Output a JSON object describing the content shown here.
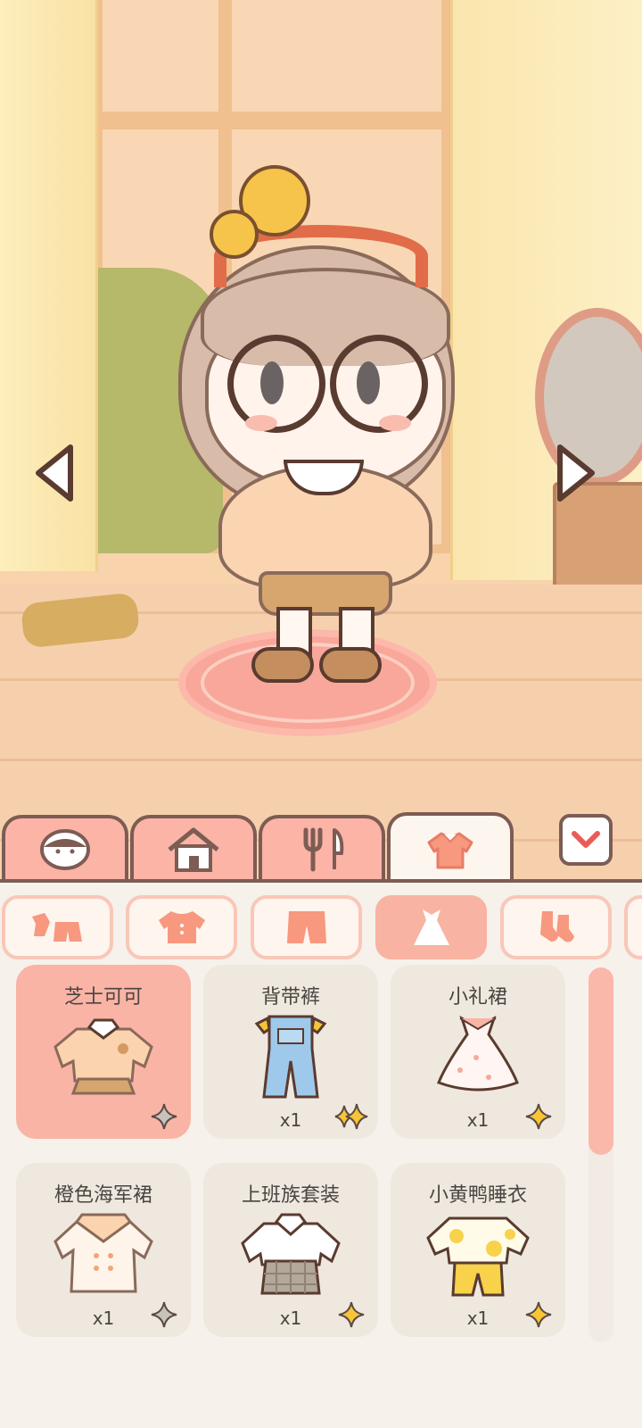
{
  "scene": {
    "prev_arrow": "chevron-left-icon",
    "next_arrow": "chevron-right-icon"
  },
  "main_tabs": [
    {
      "name": "face",
      "icon": "face-icon",
      "active": false
    },
    {
      "name": "home",
      "icon": "house-icon",
      "active": false
    },
    {
      "name": "food",
      "icon": "fork-knife-icon",
      "active": false
    },
    {
      "name": "clothes",
      "icon": "shirt-icon",
      "active": true
    }
  ],
  "collapse_icon": "chevron-down-icon",
  "sub_tabs": [
    {
      "name": "all",
      "icon": "outfit-set-icon",
      "active": false
    },
    {
      "name": "tops",
      "icon": "top-icon",
      "active": false
    },
    {
      "name": "bottoms",
      "icon": "pants-icon",
      "active": false
    },
    {
      "name": "dresses",
      "icon": "dress-icon",
      "active": true
    },
    {
      "name": "socks",
      "icon": "socks-icon",
      "active": false
    }
  ],
  "items": [
    {
      "title": "芝士可可",
      "qty": "",
      "star": "gray",
      "selected": true
    },
    {
      "title": "背带裤",
      "qty": "x1",
      "star": "gold-double",
      "selected": false
    },
    {
      "title": "小礼裙",
      "qty": "x1",
      "star": "gold",
      "selected": false
    },
    {
      "title": "橙色海军裙",
      "qty": "x1",
      "star": "gray",
      "selected": false
    },
    {
      "title": "上班族套装",
      "qty": "x1",
      "star": "gold",
      "selected": false
    },
    {
      "title": "小黄鸭睡衣",
      "qty": "x1",
      "star": "gold",
      "selected": false
    }
  ],
  "colors": {
    "accent": "#f9b4a5",
    "outline": "#7d5c54",
    "card_bg": "#efe8de",
    "gold_star": "#f7c536",
    "gray_star": "#c9c2bc"
  }
}
